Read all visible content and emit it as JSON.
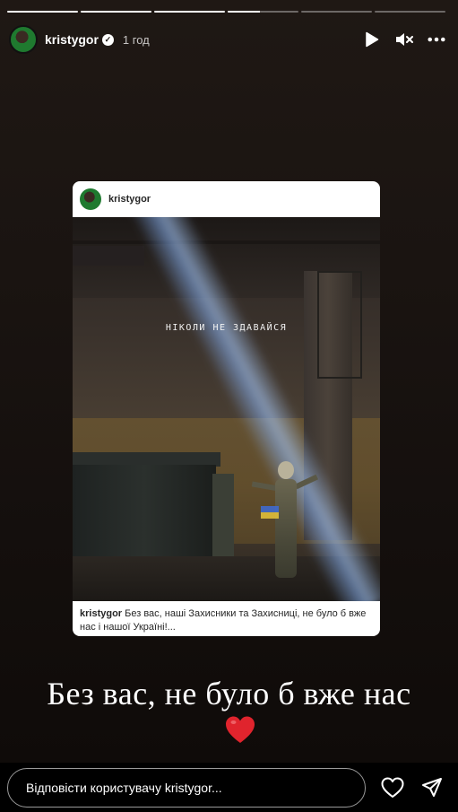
{
  "progress": [
    1,
    1,
    1,
    0.45,
    0,
    0
  ],
  "header": {
    "username": "kristygor",
    "time": "1 год",
    "verified_glyph": "✓",
    "icons": [
      "play-icon",
      "mute-icon",
      "more-icon"
    ]
  },
  "post": {
    "username": "kristygor",
    "overlay_text": "НІКОЛИ НЕ ЗДАВАЙСЯ",
    "caption_user": "kristygor",
    "caption_text": "Без вас, наші Захисники та Захисниці, не було б вже нас і нашої Україні!..."
  },
  "story_text": "Без вас, не було б вже нас",
  "reply": {
    "placeholder": "Відповісти користувачу kristygor..."
  },
  "colors": {
    "heart": "#e0242d",
    "background": "#1a1411"
  }
}
